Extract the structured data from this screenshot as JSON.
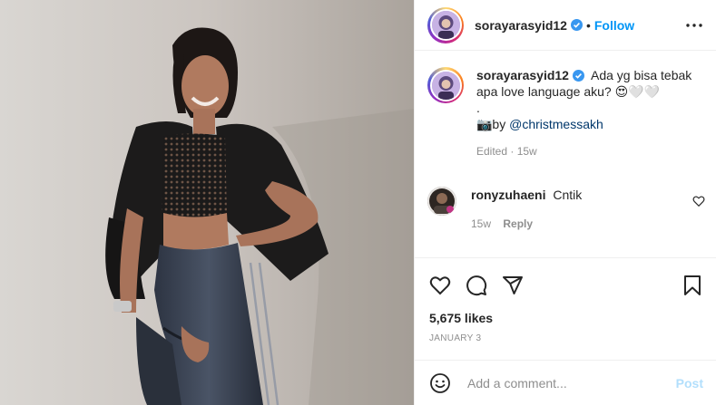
{
  "post": {
    "username": "sorayarasyid12",
    "follow_label": "Follow",
    "separator": "•",
    "caption": {
      "username": "sorayarasyid12",
      "line1": "Ada yg bisa tebak apa love language aku? 😍🤍🤍",
      "line2": ".",
      "line3_prefix": "📷by ",
      "mention": "@christmessakh",
      "meta": "Edited · 15w"
    },
    "comments": [
      {
        "username": "ronyzuhaeni",
        "text": "Cntik",
        "age": "15w",
        "reply_label": "Reply"
      }
    ],
    "likes": "5,675 likes",
    "date": "JANUARY 3",
    "add_comment": {
      "placeholder": "Add a comment...",
      "post_label": "Post"
    }
  },
  "icons": {
    "more": "more-options-icon",
    "verified": "verified-badge-icon",
    "like": "heart-icon",
    "comment": "comment-icon",
    "share": "share-icon",
    "save": "bookmark-icon",
    "emoji": "emoji-icon"
  },
  "colors": {
    "follow": "#0095f6",
    "mention": "#00376b",
    "verified": "#3897f0",
    "post_disabled": "#b2dffc",
    "muted": "#8e8e8e"
  }
}
